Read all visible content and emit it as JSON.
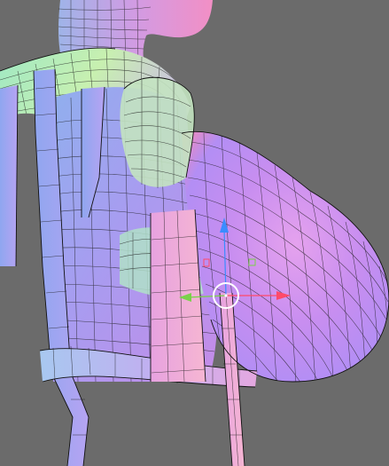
{
  "viewport": {
    "background": "#6b6b6b",
    "shading": "normal-map",
    "wireframe": true,
    "selected_vertex": true
  },
  "gizmo": {
    "axes": [
      {
        "axis": "x",
        "color": "#ff4a6a",
        "icon": "arrow-right-icon"
      },
      {
        "axis": "y",
        "color": "#7ad14a",
        "icon": "arrow-left-icon"
      },
      {
        "axis": "z",
        "color": "#3a8cff",
        "icon": "arrow-up-icon"
      }
    ],
    "center_icon": "transform-center-circle-icon",
    "plane_handles": [
      "yz-plane-handle",
      "xz-plane-handle"
    ]
  }
}
